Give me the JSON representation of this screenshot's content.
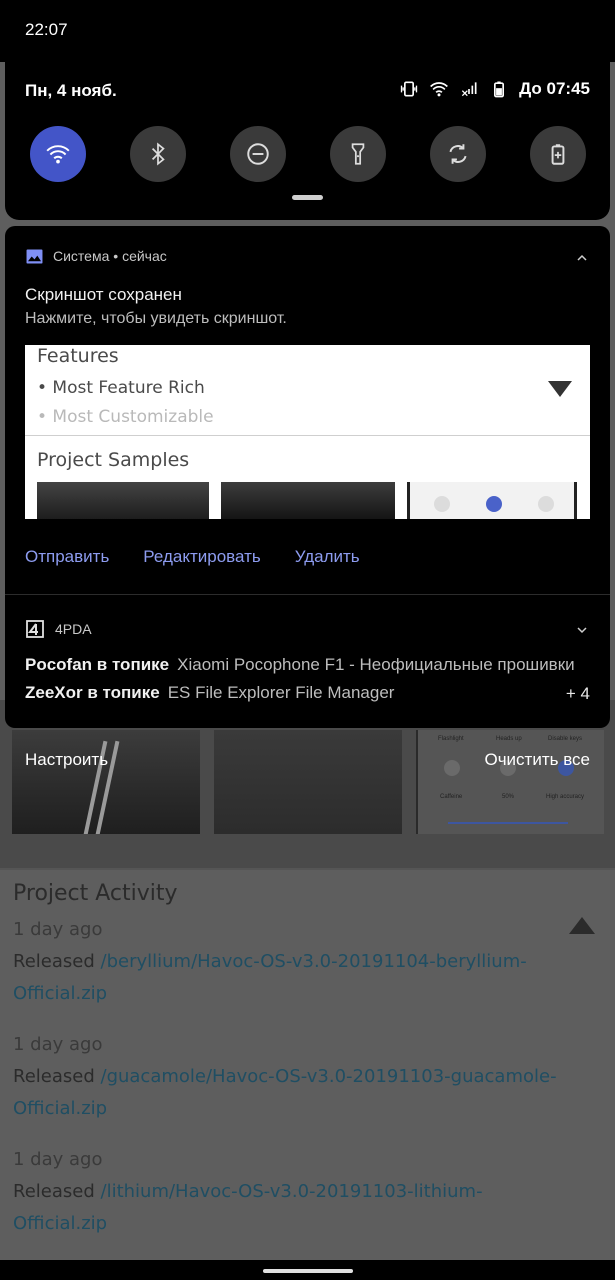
{
  "status_bar": {
    "time": "22:07"
  },
  "quick_settings": {
    "date": "Пн, 4 нояб.",
    "battery_text": "До 07:45",
    "tiles": [
      {
        "icon": "wifi-icon",
        "active": true
      },
      {
        "icon": "bluetooth-icon",
        "active": false
      },
      {
        "icon": "do-not-disturb-icon",
        "active": false
      },
      {
        "icon": "flashlight-icon",
        "active": false
      },
      {
        "icon": "auto-rotate-icon",
        "active": false
      },
      {
        "icon": "battery-saver-icon",
        "active": false
      }
    ]
  },
  "notifications": {
    "screenshot": {
      "app": "Система • сейчас",
      "title": "Скриншот сохранен",
      "text": "Нажмите, чтобы увидеть скриншот.",
      "preview": {
        "features": "Features",
        "item1": "• Most Feature Rich",
        "item2": "• Most Customizable",
        "samples": "Project Samples"
      },
      "actions": [
        "Отправить",
        "Редактировать",
        "Удалить"
      ]
    },
    "fourpda": {
      "app": "4PDA",
      "lines": [
        {
          "author": "Pocofan в топике",
          "topic": "Xiaomi Pocophone F1 - Неофициальные прошивки"
        },
        {
          "author": "ZeeXor в топике",
          "topic": "ES File Explorer File Manager"
        }
      ],
      "more": "+ 4"
    }
  },
  "shade_buttons": {
    "manage": "Настроить",
    "clear_all": "Очистить все"
  },
  "background_page": {
    "thumb_ui_labels": [
      "Flashlight",
      "Heads up",
      "Disable keys",
      "Caffeine",
      "50%",
      "High accuracy"
    ],
    "section_title": "Project Activity",
    "activities": [
      {
        "time": "1 day ago",
        "released": "Released",
        "link": "/beryllium/Havoc-OS-v3.0-20191104-beryllium-Official.zip"
      },
      {
        "time": "1 day ago",
        "released": "Released",
        "link": "/guacamole/Havoc-OS-v3.0-20191103-guacamole-Official.zip"
      },
      {
        "time": "1 day ago",
        "released": "Released",
        "link": "/lithium/Havoc-OS-v3.0-20191103-lithium-Official.zip"
      }
    ]
  },
  "colors": {
    "accent_tile": "#4355c8",
    "action_text": "#8d9cf0",
    "link": "#1f4e63"
  }
}
